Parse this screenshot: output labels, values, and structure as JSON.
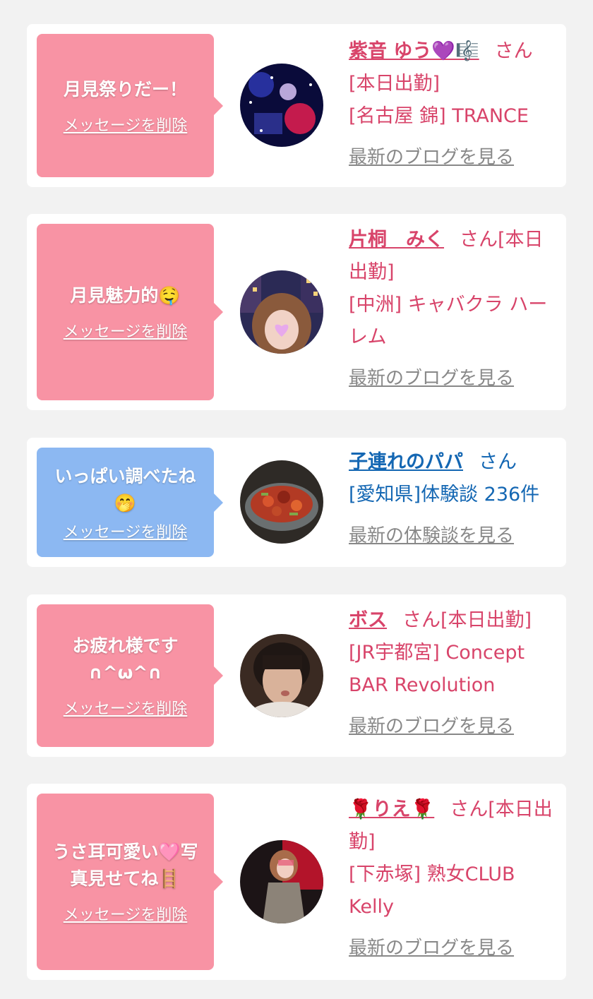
{
  "delete_label": "メッセージを削除",
  "san_suffix": "さん",
  "cards": [
    {
      "message": "月見祭りだー！",
      "name": "紫音 ゆう💜🎼",
      "line1_suffix": "",
      "detail1": "[本日出勤]",
      "detail2": "[名古屋 錦] TRANCE",
      "link": "最新のブログを見る"
    },
    {
      "message": "月見魅力的🤤",
      "name": "片桐　みく",
      "line1_suffix": "[本日出勤]",
      "detail1": "",
      "detail2": "[中洲] キャバクラ ハーレム",
      "link": "最新のブログを見る"
    },
    {
      "message": "いっぱい調べたね🤭",
      "name": "子連れのパパ",
      "line1_suffix": "",
      "detail1": "[愛知県]体験談 236件",
      "detail2": "",
      "link": "最新の体験談を見る"
    },
    {
      "message": "お疲れ様です\n∩^ω^∩",
      "name": "ボス",
      "line1_suffix": "[本日出勤]",
      "detail1": "",
      "detail2": "[JR宇都宮] Concept BAR Revolution",
      "link": "最新のブログを見る"
    },
    {
      "message": "うさ耳可愛い🩷写真見せてね🪜",
      "name": "🌹りえ🌹",
      "line1_suffix": "[本日出勤]",
      "detail1": "",
      "detail2": "[下赤塚] 熟女CLUB Kelly",
      "link": "最新のブログを見る"
    }
  ]
}
